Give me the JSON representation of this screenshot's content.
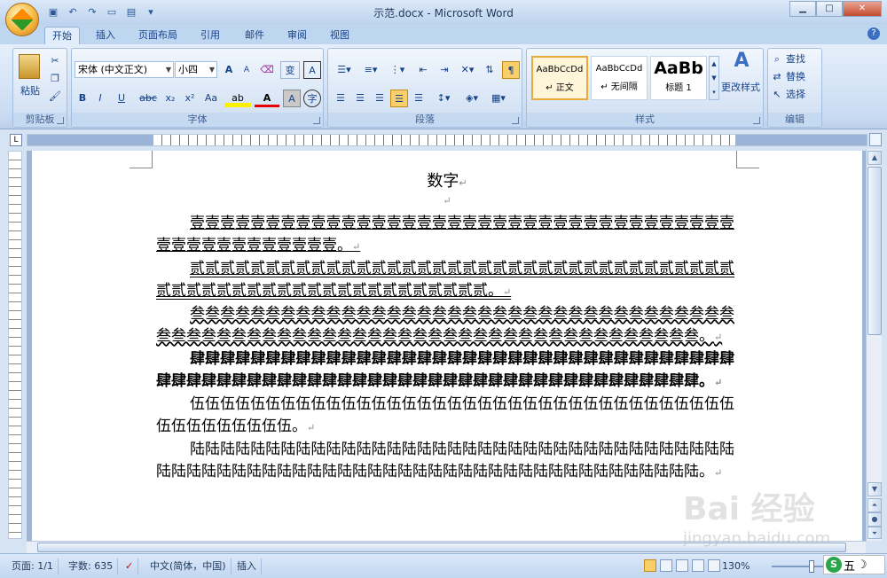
{
  "window": {
    "title": "示范.docx - Microsoft Word",
    "min": "▁",
    "max": "□",
    "close": "✕"
  },
  "qat": [
    "save-icon",
    "undo-icon",
    "redo-icon",
    "new-icon",
    "print-icon",
    "customize-icon"
  ],
  "tabs": [
    "开始",
    "插入",
    "页面布局",
    "引用",
    "邮件",
    "审阅",
    "视图"
  ],
  "ribbon": {
    "clipboard": {
      "label": "剪贴板",
      "paste": "粘贴"
    },
    "font": {
      "label": "字体",
      "face": "宋体 (中文正文)",
      "size": "小四",
      "bold": "B",
      "italic": "I",
      "underline": "U",
      "strike": "abc",
      "sub": "x₂",
      "sup": "x²",
      "case": "Aa",
      "grow": "A",
      "shrink": "A",
      "wen": "变",
      "clear": "A",
      "phon": "A"
    },
    "paragraph": {
      "label": "段落"
    },
    "styles": {
      "label": "样式",
      "items": [
        {
          "preview": "AaBbCcDd",
          "name": "↵ 正文"
        },
        {
          "preview": "AaBbCcDd",
          "name": "↵ 无间隔"
        },
        {
          "preview": "AaBb",
          "name": "标题 1"
        }
      ],
      "change": "更改样式"
    },
    "editing": {
      "label": "编辑",
      "find": "查找",
      "replace": "替换",
      "select": "选择"
    }
  },
  "ruler": {
    "corner": "L"
  },
  "document": {
    "title": "数字",
    "para_mark": "↵",
    "paragraphs": [
      "壹壹壹壹壹壹壹壹壹壹壹壹壹壹壹壹壹壹壹壹壹壹壹壹壹壹壹壹壹壹壹壹壹壹壹壹壹壹壹壹壹壹壹壹壹壹壹壹。",
      "贰贰贰贰贰贰贰贰贰贰贰贰贰贰贰贰贰贰贰贰贰贰贰贰贰贰贰贰贰贰贰贰贰贰贰贰贰贰贰贰贰贰贰贰贰贰贰贰贰贰贰贰贰贰贰贰贰贰。",
      "叁叁叁叁叁叁叁叁叁叁叁叁叁叁叁叁叁叁叁叁叁叁叁叁叁叁叁叁叁叁叁叁叁叁叁叁叁叁叁叁叁叁叁叁叁叁叁叁叁叁叁叁叁叁叁叁叁叁叁叁叁叁叁叁叁叁叁叁叁叁叁叁。",
      "肆肆肆肆肆肆肆肆肆肆肆肆肆肆肆肆肆肆肆肆肆肆肆肆肆肆肆肆肆肆肆肆肆肆肆肆肆肆肆肆肆肆肆肆肆肆肆肆肆肆肆肆肆肆肆肆肆肆肆肆肆肆肆肆肆肆肆肆肆肆肆肆。",
      "伍伍伍伍伍伍伍伍伍伍伍伍伍伍伍伍伍伍伍伍伍伍伍伍伍伍伍伍伍伍伍伍伍伍伍伍伍伍伍伍伍伍伍伍伍。",
      "陆陆陆陆陆陆陆陆陆陆陆陆陆陆陆陆陆陆陆陆陆陆陆陆陆陆陆陆陆陆陆陆陆陆陆陆陆陆陆陆陆陆陆陆陆陆陆陆陆陆陆陆陆陆陆陆陆陆陆陆陆陆陆陆陆陆陆陆陆陆陆陆。"
    ]
  },
  "status": {
    "page": "页面: 1/1",
    "words": "字数: 635",
    "lang": "中文(简体，中国)",
    "mode": "插入",
    "zoom": "130%"
  },
  "watermark": {
    "logo": "Bai 经验",
    "url": "jingyan.baidu.com"
  },
  "ime": {
    "a": "五",
    "b": "☽"
  }
}
